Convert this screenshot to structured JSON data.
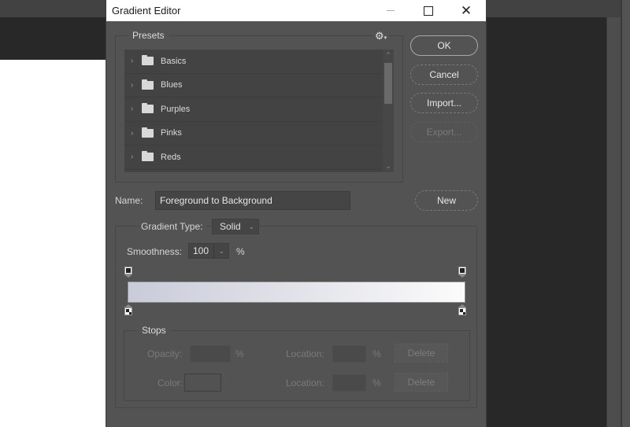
{
  "dialog": {
    "title": "Gradient Editor",
    "window_controls": {
      "minimize": "—",
      "maximize": "☐",
      "close": "✕"
    }
  },
  "presets": {
    "title": "Presets",
    "settings_icon": "gear-icon",
    "items": [
      {
        "label": "Basics"
      },
      {
        "label": "Blues"
      },
      {
        "label": "Purples"
      },
      {
        "label": "Pinks"
      },
      {
        "label": "Reds"
      }
    ]
  },
  "buttons": {
    "ok": "OK",
    "cancel": "Cancel",
    "import": "Import...",
    "export": "Export...",
    "new": "New"
  },
  "name": {
    "label": "Name:",
    "value": "Foreground to Background"
  },
  "gradient_type": {
    "label": "Gradient Type:",
    "value": "Solid"
  },
  "smoothness": {
    "label": "Smoothness:",
    "value": "100",
    "unit": "%"
  },
  "gradient": {
    "start_color": "#c9cbd8",
    "end_color": "#fbfbfb"
  },
  "stops": {
    "title": "Stops",
    "opacity_label": "Opacity:",
    "opacity_unit": "%",
    "color_label": "Color:",
    "location_label": "Location:",
    "location_unit": "%",
    "delete_label": "Delete"
  }
}
